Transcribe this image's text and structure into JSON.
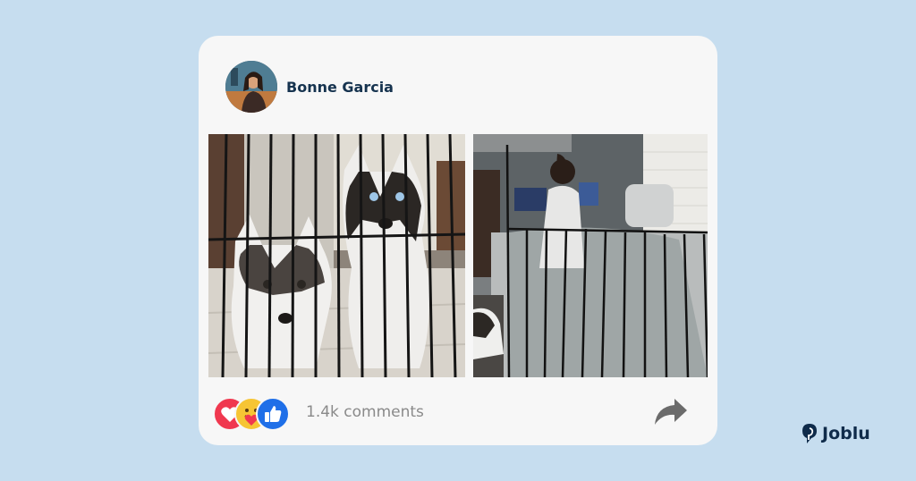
{
  "post": {
    "author_name": "Bonne Garcia",
    "avatar": "profile-photo",
    "photos": [
      {
        "subject": "two husky puppies behind a black wire cage"
      },
      {
        "subject": "woman working on a laptop inside a dog playpen with a husky outside"
      }
    ],
    "reactions": [
      "love-icon",
      "care-icon",
      "like-icon"
    ],
    "comments_label": "1.4k comments",
    "share_icon": "share-arrow-icon"
  },
  "brand": {
    "name": "Joblu",
    "icon": "joblu-logo-icon"
  },
  "colors": {
    "background": "#c6ddef",
    "card": "#f7f7f7",
    "author_text": "#16334f",
    "love": "#f0384f",
    "care": "#f6c534",
    "like": "#1f6fe8",
    "comment_text": "#8a8a8a",
    "brand": "#0f2b4a"
  }
}
